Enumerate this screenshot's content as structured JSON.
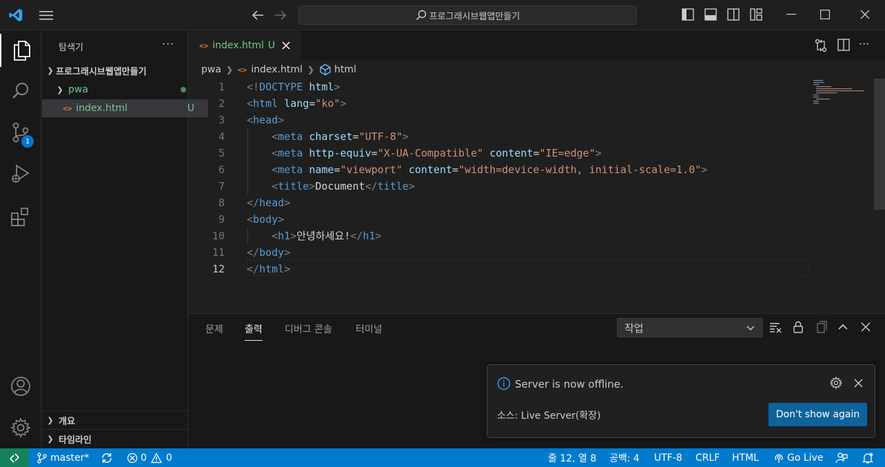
{
  "titlebar": {
    "search_text": "프로그래시브웹앱만들기"
  },
  "activity": {
    "scm_badge": "1"
  },
  "sidebar": {
    "title": "탐색기",
    "more": "···",
    "root_folder": "프로그래시브웹앱만들기",
    "folder": "pwa",
    "file": "index.html",
    "file_status": "U",
    "file_icon": "<>",
    "sections": [
      "개요",
      "타임라인"
    ]
  },
  "editor": {
    "tab": {
      "icon": "<>",
      "name": "index.html",
      "status": "U"
    },
    "breadcrumb": [
      "pwa",
      "index.html",
      "html"
    ],
    "current_line": 12,
    "lines": [
      [
        [
          "t-br",
          "<!"
        ],
        [
          "t-tag",
          "DOCTYPE"
        ],
        [
          "t-txt",
          " "
        ],
        [
          "t-attr",
          "html"
        ],
        [
          "t-br",
          ">"
        ]
      ],
      [
        [
          "t-br",
          "<"
        ],
        [
          "t-tag",
          "html"
        ],
        [
          "t-txt",
          " "
        ],
        [
          "t-attr",
          "lang"
        ],
        [
          "t-txt",
          "="
        ],
        [
          "t-str",
          "\"ko\""
        ],
        [
          "t-br",
          ">"
        ]
      ],
      [
        [
          "t-br",
          "<"
        ],
        [
          "t-tag",
          "head"
        ],
        [
          "t-br",
          ">"
        ]
      ],
      [
        [
          "t-txt",
          "    "
        ],
        [
          "t-br",
          "<"
        ],
        [
          "t-tag",
          "meta"
        ],
        [
          "t-txt",
          " "
        ],
        [
          "t-attr",
          "charset"
        ],
        [
          "t-txt",
          "="
        ],
        [
          "t-str",
          "\"UTF-8\""
        ],
        [
          "t-br",
          ">"
        ]
      ],
      [
        [
          "t-txt",
          "    "
        ],
        [
          "t-br",
          "<"
        ],
        [
          "t-tag",
          "meta"
        ],
        [
          "t-txt",
          " "
        ],
        [
          "t-attr",
          "http-equiv"
        ],
        [
          "t-txt",
          "="
        ],
        [
          "t-str",
          "\"X-UA-Compatible\""
        ],
        [
          "t-txt",
          " "
        ],
        [
          "t-attr",
          "content"
        ],
        [
          "t-txt",
          "="
        ],
        [
          "t-str",
          "\"IE=edge\""
        ],
        [
          "t-br",
          ">"
        ]
      ],
      [
        [
          "t-txt",
          "    "
        ],
        [
          "t-br",
          "<"
        ],
        [
          "t-tag",
          "meta"
        ],
        [
          "t-txt",
          " "
        ],
        [
          "t-attr",
          "name"
        ],
        [
          "t-txt",
          "="
        ],
        [
          "t-str",
          "\"viewport\""
        ],
        [
          "t-txt",
          " "
        ],
        [
          "t-attr",
          "content"
        ],
        [
          "t-txt",
          "="
        ],
        [
          "t-str",
          "\"width=device-width, initial-scale=1.0\""
        ],
        [
          "t-br",
          ">"
        ]
      ],
      [
        [
          "t-txt",
          "    "
        ],
        [
          "t-br",
          "<"
        ],
        [
          "t-tag",
          "title"
        ],
        [
          "t-br",
          ">"
        ],
        [
          "t-txt",
          "Document"
        ],
        [
          "t-br",
          "</"
        ],
        [
          "t-tag",
          "title"
        ],
        [
          "t-br",
          ">"
        ]
      ],
      [
        [
          "t-br",
          "</"
        ],
        [
          "t-tag",
          "head"
        ],
        [
          "t-br",
          ">"
        ]
      ],
      [
        [
          "t-br",
          "<"
        ],
        [
          "t-tag",
          "body"
        ],
        [
          "t-br",
          ">"
        ]
      ],
      [
        [
          "t-txt",
          "    "
        ],
        [
          "t-br",
          "<"
        ],
        [
          "t-tag",
          "h1"
        ],
        [
          "t-br",
          ">"
        ],
        [
          "t-txt",
          "안녕하세요!"
        ],
        [
          "t-br",
          "</"
        ],
        [
          "t-tag",
          "h1"
        ],
        [
          "t-br",
          ">"
        ]
      ],
      [
        [
          "t-br",
          "</"
        ],
        [
          "t-tag",
          "body"
        ],
        [
          "t-br",
          ">"
        ]
      ],
      [
        [
          "t-br",
          "</"
        ],
        [
          "t-tag",
          "html"
        ],
        [
          "t-br",
          ">"
        ]
      ]
    ]
  },
  "panel": {
    "tabs": [
      "문제",
      "출력",
      "디버그 콘솔",
      "터미널"
    ],
    "active_tab": "출력",
    "output_channel": "작업"
  },
  "notification": {
    "message": "Server is now offline.",
    "source": "소스: Live Server(확장)",
    "button": "Don't show again"
  },
  "statusbar": {
    "branch": "master*",
    "errors": "0",
    "warnings": "0",
    "position": "줄 12, 열 8",
    "spaces": "공백: 4",
    "encoding": "UTF-8",
    "eol": "CRLF",
    "language": "HTML",
    "golive": "Go Live"
  },
  "colors": {
    "accent": "#007acc",
    "remote": "#16825d",
    "untracked": "#73c991",
    "button": "#0e639c"
  }
}
